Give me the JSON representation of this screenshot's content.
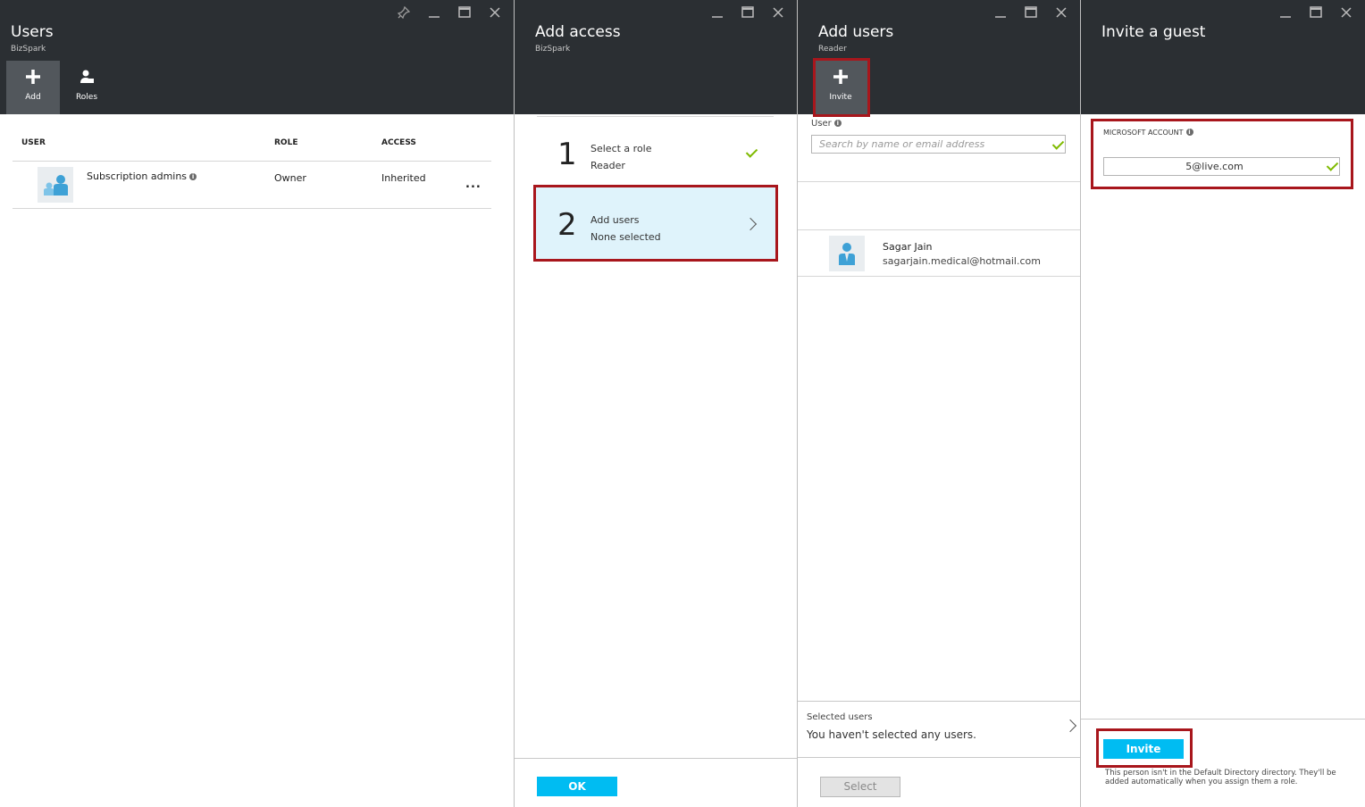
{
  "users_blade": {
    "title": "Users",
    "subtitle": "BizSpark",
    "commands": [
      {
        "label": "Add",
        "icon": "plus-icon"
      },
      {
        "label": "Roles",
        "icon": "roles-icon"
      }
    ],
    "table": {
      "headers": [
        "USER",
        "ROLE",
        "ACCESS"
      ],
      "rows": [
        {
          "user": "Subscription admins",
          "role": "Owner",
          "access": "Inherited",
          "more": "..."
        }
      ]
    }
  },
  "add_access_blade": {
    "title": "Add access",
    "subtitle": "BizSpark",
    "steps": [
      {
        "number": "1",
        "title": "Select a role",
        "value": "Reader"
      },
      {
        "number": "2",
        "title": "Add users",
        "value": "None selected"
      }
    ],
    "ok_label": "OK"
  },
  "add_users_blade": {
    "title": "Add users",
    "subtitle": "Reader",
    "command": {
      "label": "Invite",
      "icon": "plus-icon"
    },
    "user_label": "User",
    "search_placeholder": "Search by name or email address",
    "results": [
      {
        "name": "Sagar Jain",
        "email": "sagarjain.medical@hotmail.com"
      }
    ],
    "selected_users_label": "Selected users",
    "selected_users_text": "You haven't selected any users.",
    "select_label": "Select"
  },
  "invite_blade": {
    "title": "Invite a guest",
    "account_label": "MICROSOFT ACCOUNT",
    "account_value": "5@live.com",
    "invite_label": "Invite",
    "note": "This person isn't in the Default Directory directory. They'll be added automatically when you assign them a role."
  },
  "colors": {
    "header_bg": "#2b2f33",
    "accent_blue": "#00bcf2",
    "highlight_red": "#a8161c",
    "selected_step_bg": "#dff3fb",
    "check_green": "#7fba00"
  }
}
